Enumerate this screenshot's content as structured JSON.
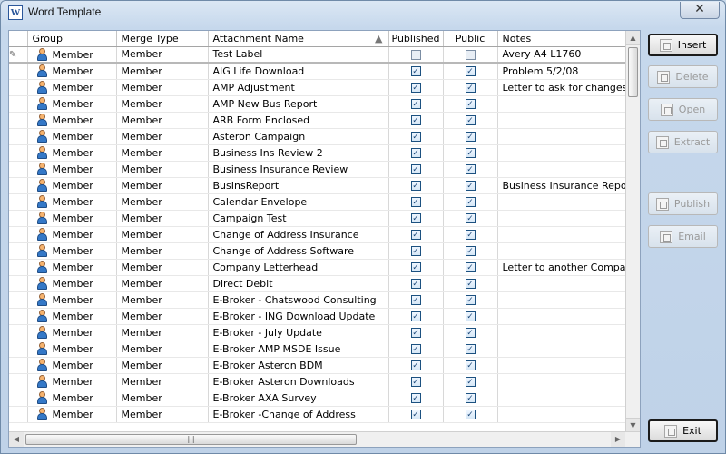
{
  "window": {
    "title": "Word Template",
    "close_label": "✕"
  },
  "columns": [
    "Group",
    "Merge Type",
    "Attachment Name",
    "Published",
    "Public",
    "Notes"
  ],
  "rows": [
    {
      "group": "Member",
      "merge_type": "Member",
      "attachment": "Test Label",
      "published": false,
      "public": false,
      "notes": "Avery A4 L1760"
    },
    {
      "group": "Member",
      "merge_type": "Member",
      "attachment": "AIG Life Download",
      "published": true,
      "public": true,
      "notes": "Problem 5/2/08"
    },
    {
      "group": "Member",
      "merge_type": "Member",
      "attachment": "AMP Adjustment",
      "published": true,
      "public": true,
      "notes": "Letter to ask for changes to A"
    },
    {
      "group": "Member",
      "merge_type": "Member",
      "attachment": "AMP New Bus Report",
      "published": true,
      "public": true,
      "notes": ""
    },
    {
      "group": "Member",
      "merge_type": "Member",
      "attachment": "ARB Form Enclosed",
      "published": true,
      "public": true,
      "notes": ""
    },
    {
      "group": "Member",
      "merge_type": "Member",
      "attachment": "Asteron Campaign",
      "published": true,
      "public": true,
      "notes": ""
    },
    {
      "group": "Member",
      "merge_type": "Member",
      "attachment": "Business Ins Review 2",
      "published": true,
      "public": true,
      "notes": ""
    },
    {
      "group": "Member",
      "merge_type": "Member",
      "attachment": "Business Insurance Review",
      "published": true,
      "public": true,
      "notes": ""
    },
    {
      "group": "Member",
      "merge_type": "Member",
      "attachment": "BusInsReport",
      "published": true,
      "public": true,
      "notes": "Business Insurance Report"
    },
    {
      "group": "Member",
      "merge_type": "Member",
      "attachment": "Calendar Envelope",
      "published": true,
      "public": true,
      "notes": ""
    },
    {
      "group": "Member",
      "merge_type": "Member",
      "attachment": "Campaign Test",
      "published": true,
      "public": true,
      "notes": ""
    },
    {
      "group": "Member",
      "merge_type": "Member",
      "attachment": "Change of Address Insurance",
      "published": true,
      "public": true,
      "notes": ""
    },
    {
      "group": "Member",
      "merge_type": "Member",
      "attachment": "Change of Address Software",
      "published": true,
      "public": true,
      "notes": ""
    },
    {
      "group": "Member",
      "merge_type": "Member",
      "attachment": "Company Letterhead",
      "published": true,
      "public": true,
      "notes": "Letter to another Company or"
    },
    {
      "group": "Member",
      "merge_type": "Member",
      "attachment": "Direct Debit",
      "published": true,
      "public": true,
      "notes": ""
    },
    {
      "group": "Member",
      "merge_type": "Member",
      "attachment": "E-Broker - Chatswood Consulting",
      "published": true,
      "public": true,
      "notes": ""
    },
    {
      "group": "Member",
      "merge_type": "Member",
      "attachment": "E-Broker - ING Download Update",
      "published": true,
      "public": true,
      "notes": ""
    },
    {
      "group": "Member",
      "merge_type": "Member",
      "attachment": "E-Broker - July Update",
      "published": true,
      "public": true,
      "notes": ""
    },
    {
      "group": "Member",
      "merge_type": "Member",
      "attachment": "E-Broker AMP MSDE Issue",
      "published": true,
      "public": true,
      "notes": ""
    },
    {
      "group": "Member",
      "merge_type": "Member",
      "attachment": "E-Broker Asteron BDM",
      "published": true,
      "public": true,
      "notes": ""
    },
    {
      "group": "Member",
      "merge_type": "Member",
      "attachment": "E-Broker Asteron Downloads",
      "published": true,
      "public": true,
      "notes": ""
    },
    {
      "group": "Member",
      "merge_type": "Member",
      "attachment": "E-Broker AXA Survey",
      "published": true,
      "public": true,
      "notes": ""
    },
    {
      "group": "Member",
      "merge_type": "Member",
      "attachment": "E-Broker -Change of Address",
      "published": true,
      "public": true,
      "notes": ""
    }
  ],
  "buttons": {
    "insert": "Insert",
    "delete": "Delete",
    "open": "Open",
    "extract": "Extract",
    "publish": "Publish",
    "email": "Email",
    "exit": "Exit"
  },
  "scroll": {
    "up": "▲",
    "down": "▼",
    "left": "◀",
    "right": "▶",
    "grip": "|||"
  },
  "icons": {
    "app": "word-icon",
    "member": "member-icon",
    "edit": "pencil-icon"
  }
}
